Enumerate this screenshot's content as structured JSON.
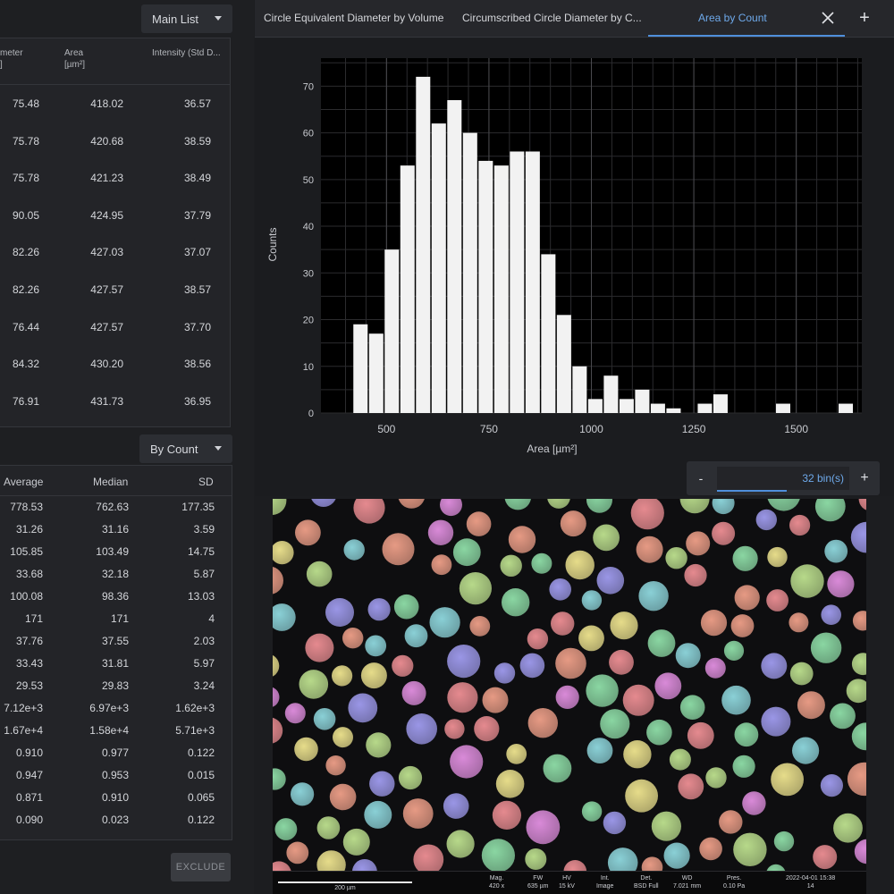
{
  "left": {
    "main_list_dropdown": "Main List",
    "main_table": {
      "headers": [
        {
          "line1": "meter",
          "line2": "]"
        },
        {
          "line1": "Area",
          "line2": "[µm²]"
        },
        {
          "line1": "Intensity (Std D...",
          "line2": ""
        }
      ],
      "rows": [
        [
          "75.48",
          "418.02",
          "36.57"
        ],
        [
          "75.78",
          "420.68",
          "38.59"
        ],
        [
          "75.78",
          "421.23",
          "38.49"
        ],
        [
          "90.05",
          "424.95",
          "37.79"
        ],
        [
          "82.26",
          "427.03",
          "37.07"
        ],
        [
          "82.26",
          "427.57",
          "38.57"
        ],
        [
          "76.44",
          "427.57",
          "37.70"
        ],
        [
          "84.32",
          "430.20",
          "38.56"
        ],
        [
          "76.91",
          "431.73",
          "36.95"
        ]
      ]
    },
    "stats_dropdown": "By Count",
    "stats_table": {
      "headers": [
        "Average",
        "Median",
        "SD"
      ],
      "rows": [
        [
          "778.53",
          "762.63",
          "177.35"
        ],
        [
          "31.26",
          "31.16",
          "3.59"
        ],
        [
          "105.85",
          "103.49",
          "14.75"
        ],
        [
          "33.68",
          "32.18",
          "5.87"
        ],
        [
          "100.08",
          "98.36",
          "13.03"
        ],
        [
          "171",
          "171",
          "4"
        ],
        [
          "37.76",
          "37.55",
          "2.03"
        ],
        [
          "33.43",
          "31.81",
          "5.97"
        ],
        [
          "29.53",
          "29.83",
          "3.24"
        ],
        [
          "7.12e+3",
          "6.97e+3",
          "1.62e+3"
        ],
        [
          "1.67e+4",
          "1.58e+4",
          "5.71e+3"
        ],
        [
          "0.910",
          "0.977",
          "0.122"
        ],
        [
          "0.947",
          "0.953",
          "0.015"
        ],
        [
          "0.871",
          "0.910",
          "0.065"
        ],
        [
          "0.090",
          "0.023",
          "0.122"
        ]
      ]
    },
    "exclude_label": "EXCLUDE"
  },
  "tabs": {
    "items": [
      "Circle Equivalent Diameter by Volume",
      "Circumscribed Circle Diameter by C..."
    ],
    "active": "Area by Count"
  },
  "bins": {
    "minus": "-",
    "value": "32 bin(s)",
    "plus": "+"
  },
  "chart_data": {
    "type": "bar",
    "xlabel": "Area [µm²]",
    "ylabel": "Counts",
    "xlim": [
      340,
      1660
    ],
    "ylim": [
      0,
      76
    ],
    "xticks": [
      500,
      750,
      1000,
      1250,
      1500
    ],
    "yticks": [
      0,
      10,
      20,
      30,
      40,
      50,
      60,
      70
    ],
    "grid": true,
    "bin_width": 38.2,
    "bin_edges_start": 418,
    "values": [
      19,
      17,
      35,
      53,
      72,
      62,
      67,
      60,
      54,
      53,
      56,
      56,
      34,
      21,
      10,
      3,
      8,
      3,
      5,
      2,
      1,
      0,
      2,
      4,
      0,
      0,
      0,
      2,
      0,
      0,
      0,
      2
    ],
    "bar_color": "#f2f2f2",
    "background": "#000000",
    "grid_color": "#2b2b2e"
  },
  "sem_footer": {
    "scale_label": "200 µm",
    "fields": [
      {
        "label": "Mag.",
        "value": "420 x"
      },
      {
        "label": "FW",
        "value": "635 µm"
      },
      {
        "label": "HV",
        "value": "15 kV"
      },
      {
        "label": "Int.",
        "value": "Image"
      },
      {
        "label": "Det.",
        "value": "BSD Full"
      },
      {
        "label": "WD",
        "value": "7.021 mm"
      },
      {
        "label": "Pres.",
        "value": "0.10 Pa"
      },
      {
        "label": "2022-04-01 15:38",
        "value": "14"
      }
    ]
  },
  "colors": {
    "accent": "#4f8fdc",
    "accent_text": "#6ea9ea",
    "panel": "#232428"
  }
}
